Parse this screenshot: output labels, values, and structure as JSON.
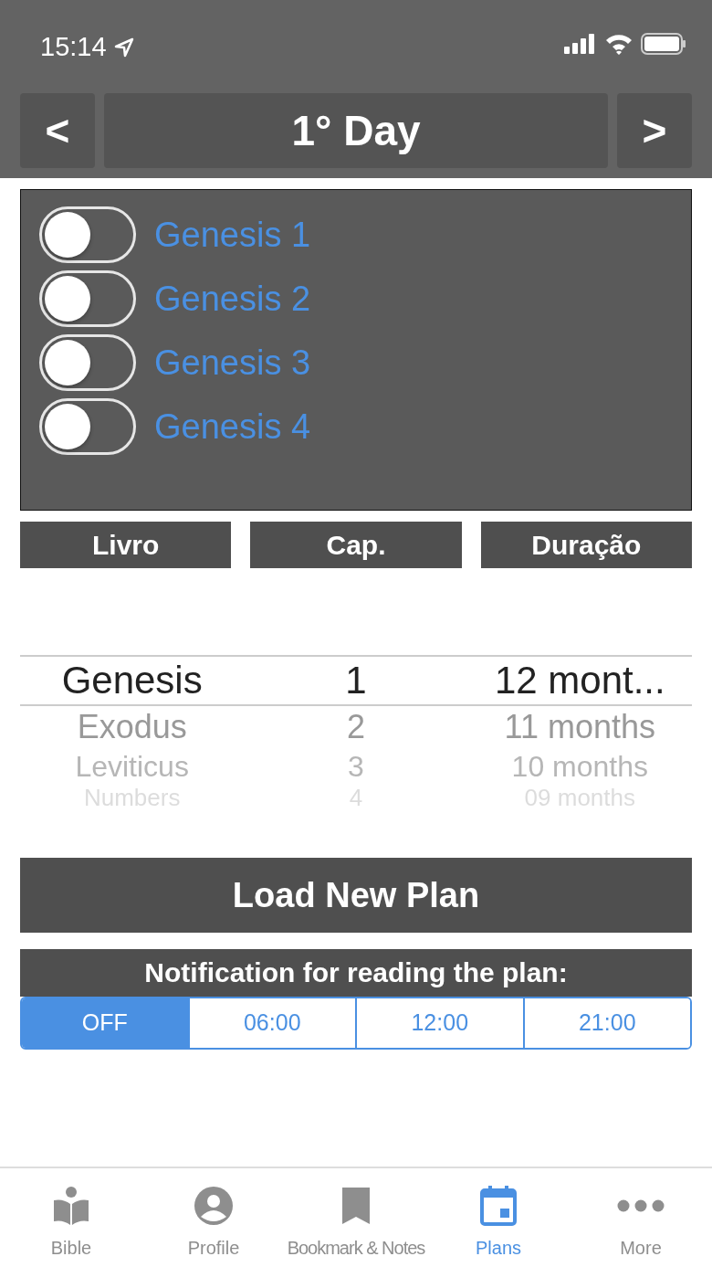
{
  "status_bar": {
    "time": "15:14"
  },
  "day_nav": {
    "title": "1° Day",
    "prev": "<",
    "next": ">"
  },
  "chapters": [
    {
      "label": "Genesis 1",
      "checked": false
    },
    {
      "label": "Genesis 2",
      "checked": false
    },
    {
      "label": "Genesis 3",
      "checked": false
    },
    {
      "label": "Genesis 4",
      "checked": false
    }
  ],
  "picker_headers": [
    "Livro",
    "Cap.",
    "Duração"
  ],
  "picker_rows": [
    {
      "book": "Genesis",
      "chapter": "1",
      "duration": "12 mont...",
      "selected": true
    },
    {
      "book": "Exodus",
      "chapter": "2",
      "duration": "11 months",
      "selected": false
    },
    {
      "book": "Leviticus",
      "chapter": "3",
      "duration": "10 months",
      "selected": false
    },
    {
      "book": "Numbers",
      "chapter": "4",
      "duration": "09 months",
      "selected": false
    }
  ],
  "load_button": "Load New Plan",
  "notification": {
    "title": "Notification for reading the plan:",
    "options": [
      {
        "label": "OFF",
        "selected": true
      },
      {
        "label": "06:00",
        "selected": false
      },
      {
        "label": "12:00",
        "selected": false
      },
      {
        "label": "21:00",
        "selected": false
      }
    ]
  },
  "tab_bar": [
    {
      "label": "Bible",
      "selected": false
    },
    {
      "label": "Profile",
      "selected": false
    },
    {
      "label": "Bookmark & Notes",
      "selected": false
    },
    {
      "label": "Plans",
      "selected": true
    },
    {
      "label": "More",
      "selected": false
    }
  ]
}
